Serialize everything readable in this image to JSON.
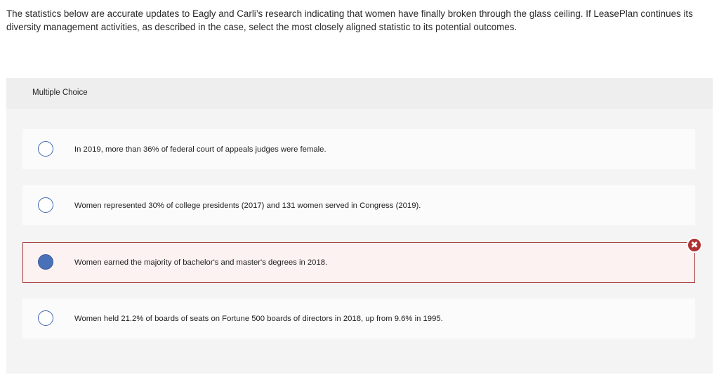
{
  "question": {
    "text": "The statistics below are accurate updates to Eagly and Carli’s research indicating that women have finally broken through the glass ceiling. If LeasePlan continues its diversity management activities, as described in the case, select the most closely aligned statistic to its potential outcomes."
  },
  "panel": {
    "label": "Multiple Choice"
  },
  "options": [
    {
      "text": "In 2019, more than 36% of federal court of appeals judges were female.",
      "selected": false
    },
    {
      "text": "Women represented 30% of college presidents (2017) and 131 women served in Congress (2019).",
      "selected": false
    },
    {
      "text": "Women earned the majority of bachelor's and master's degrees in 2018.",
      "selected": true,
      "status": "incorrect"
    },
    {
      "text": "Women held 21.2% of boards of seats on Fortune 500 boards of directors in 2018, up from 9.6% in 1995.",
      "selected": false
    }
  ],
  "feedback": {
    "icon": "x-icon",
    "glyph": "✖",
    "color": "#b03131"
  }
}
